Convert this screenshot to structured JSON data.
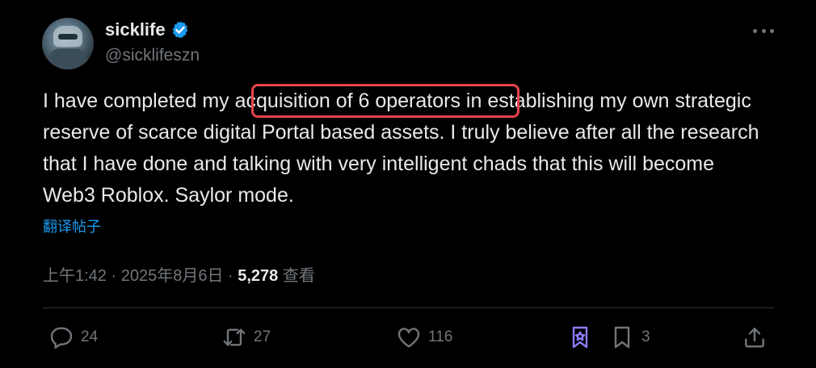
{
  "author": {
    "name": "sicklife",
    "handle": "@sicklifeszn",
    "verified": true
  },
  "tweet": {
    "before_highlight": "I have completed my ",
    "highlight": "acquisition of 6 operators",
    "after_highlight": " in establishing my own strategic reserve of scarce digital Portal based assets.  I truly believe after all the research that I have done and talking with very intelligent chads that this will become Web3 Roblox.  Saylor mode."
  },
  "translate_label": "翻译帖子",
  "meta": {
    "time": "上午1:42",
    "sep1": " · ",
    "date": "2025年8月6日",
    "sep2": " · ",
    "views": "5,278",
    "views_label": " 查看"
  },
  "actions": {
    "replies": "24",
    "reposts": "27",
    "likes": "116",
    "bookmarks": "3"
  },
  "colors": {
    "accent": "#1d9bf0",
    "highlight_border": "#e8434a",
    "grok_icon": "#8b7cf6",
    "muted": "#71767b"
  }
}
